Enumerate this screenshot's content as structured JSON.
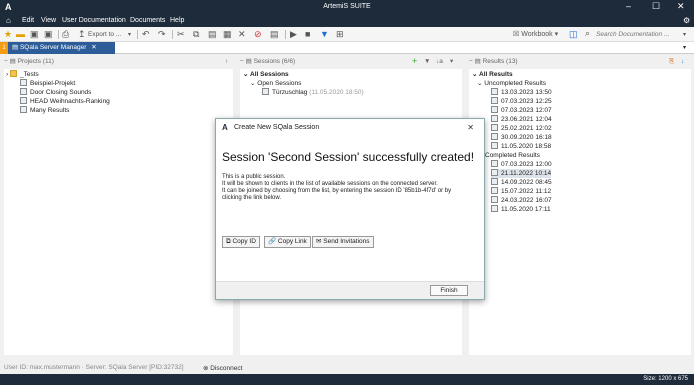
{
  "window": {
    "logo": "A",
    "title": "ArtemiS SUITE",
    "controls": [
      "–",
      "☐",
      "✕"
    ]
  },
  "menu": {
    "items": [
      "Edit",
      "View",
      "User Documentation",
      "Documents",
      "Help"
    ]
  },
  "toolbar": {
    "export_label": "Export to ...",
    "workbook_label": "Workbook",
    "search_placeholder": "Search Documentation ..."
  },
  "tab": {
    "number": "1",
    "label": "SQala Server Manager"
  },
  "projects": {
    "header": "Projects (11)",
    "items": [
      {
        "label": "_Tests",
        "type": "folder"
      },
      {
        "label": "Beispiel-Projekt",
        "type": "project"
      },
      {
        "label": "Door Closing Sounds",
        "type": "project"
      },
      {
        "label": "HEAD Weihnachts-Ranking",
        "type": "project"
      },
      {
        "label": "Many Results",
        "type": "project"
      }
    ]
  },
  "sessions": {
    "header": "Sessions (6/6)",
    "all_label": "All Sessions",
    "open_label": "Open Sessions",
    "item_label": "Türzuschlag",
    "item_date": "(11.05.2020 18:50)"
  },
  "results": {
    "header": "Results (13)",
    "all_label": "All Results",
    "uncompleted_label": "Uncompleted Results",
    "uncompleted": [
      "13.03.2023 13:50",
      "07.03.2023 12:25",
      "07.03.2023 12:07",
      "23.06.2021 12:04",
      "25.02.2021 12:02",
      "30.09.2020 16:18",
      "11.05.2020 18:58"
    ],
    "completed_label": "Completed Results",
    "completed": [
      "07.03.2023 12:00",
      "21.11.2022 10:14",
      "14.09.2022 08:45",
      "15.07.2022 11:12",
      "24.03.2022 16:07",
      "11.05.2020 17:11"
    ]
  },
  "dialog": {
    "logo": "A",
    "title": "Create New SQala Session",
    "close": "✕",
    "heading": "Session 'Second Session' successfully created!",
    "line1": "This is a public session.",
    "line2": "It will be shown to clients in the list of available sessions on the connected server.",
    "line3": "It can be joined by choosing from the list, by entering the session ID '85b1b-4f7d' or by",
    "line4": "clicking the link below.",
    "copy_id": "Copy ID",
    "copy_link": "Copy Link",
    "send_invitations": "Send Invitations",
    "finish": "Finish"
  },
  "status": {
    "user_info": "User ID: max.mustermann · Server: SQala Server [PID:32732]",
    "disconnect": "Disconnect",
    "size": "Size: 1200 x 675"
  }
}
